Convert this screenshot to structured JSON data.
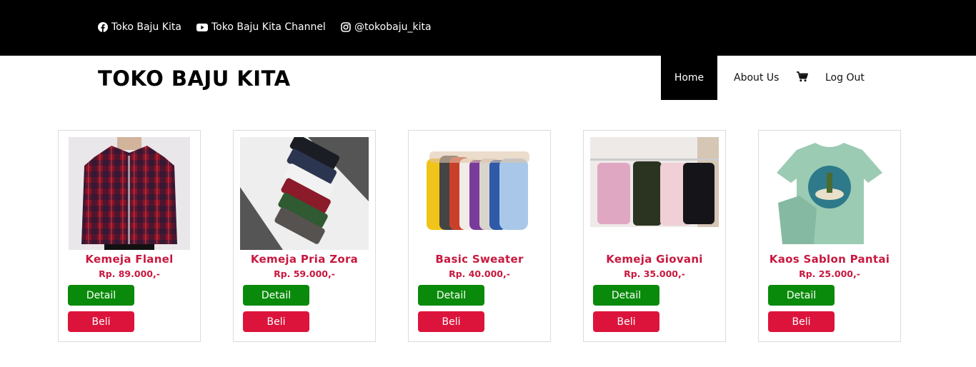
{
  "topbar": {
    "links": [
      {
        "label": "Toko Baju Kita",
        "icon": "facebook-icon"
      },
      {
        "label": "Toko Baju Kita Channel",
        "icon": "youtube-icon"
      },
      {
        "label": "@tokobaju_kita",
        "icon": "instagram-icon"
      }
    ]
  },
  "header": {
    "brand": "TOKO BAJU KITA",
    "nav": [
      {
        "label": "Home",
        "active": true
      },
      {
        "label": "About Us"
      },
      {
        "label": "",
        "icon": "cart-icon"
      },
      {
        "label": "Log Out"
      }
    ]
  },
  "products": [
    {
      "name": "Kemeja Flanel",
      "price": "Rp. 89.000,-",
      "detail_label": "Detail",
      "buy_label": "Beli"
    },
    {
      "name": "Kemeja Pria Zora",
      "price": "Rp. 59.000,-",
      "detail_label": "Detail",
      "buy_label": "Beli"
    },
    {
      "name": "Basic Sweater",
      "price": "Rp. 40.000,-",
      "detail_label": "Detail",
      "buy_label": "Beli"
    },
    {
      "name": "Kemeja Giovani",
      "price": "Rp. 35.000,-",
      "detail_label": "Detail",
      "buy_label": "Beli"
    },
    {
      "name": "Kaos Sablon Pantai",
      "price": "Rp. 25.000,-",
      "detail_label": "Detail",
      "buy_label": "Beli"
    }
  ],
  "colors": {
    "topbar_bg": "#000000",
    "product_text": "#c8183f",
    "detail_button": "#0a8a0a",
    "buy_button": "#dc143c"
  }
}
